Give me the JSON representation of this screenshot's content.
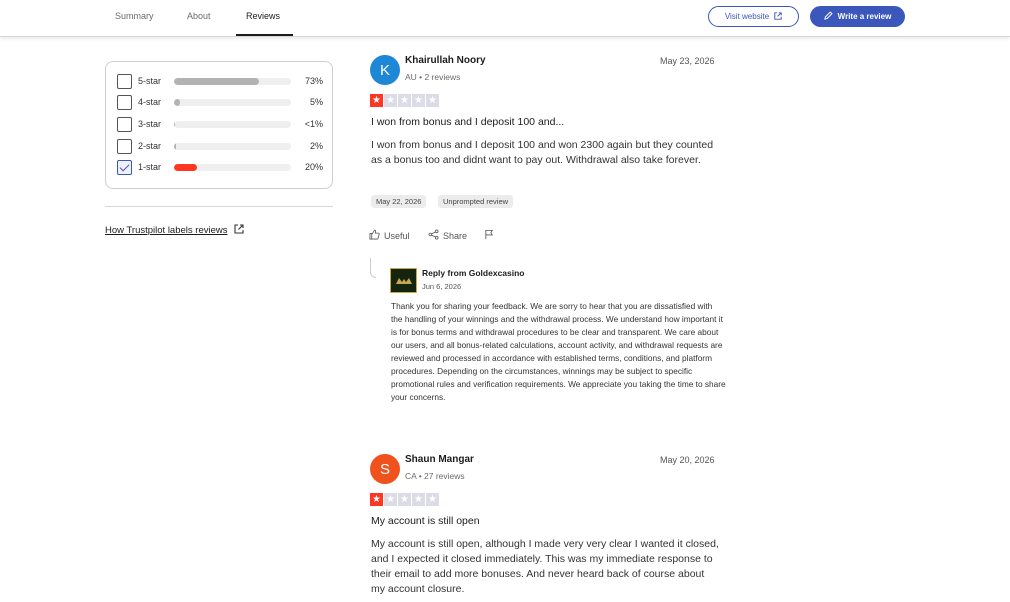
{
  "nav": {
    "tabs": [
      {
        "label": "Summary"
      },
      {
        "label": "About"
      },
      {
        "label": "Reviews"
      }
    ],
    "visit_website": "Visit website",
    "write_review": "Write a review"
  },
  "filters": [
    {
      "label": "5-star",
      "percent": "73%",
      "fraction": 0.73,
      "checked": false,
      "color": "#b3b3b3"
    },
    {
      "label": "4-star",
      "percent": "5%",
      "fraction": 0.05,
      "checked": false,
      "color": "#b3b3b3"
    },
    {
      "label": "3-star",
      "percent": "<1%",
      "fraction": 0.01,
      "checked": false,
      "color": "#b3b3b3"
    },
    {
      "label": "2-star",
      "percent": "2%",
      "fraction": 0.02,
      "checked": false,
      "color": "#b3b3b3"
    },
    {
      "label": "1-star",
      "percent": "20%",
      "fraction": 0.2,
      "checked": true,
      "color": "#ff3722"
    }
  ],
  "how_link": "How Trustpilot labels reviews",
  "reviews": [
    {
      "initial": "K",
      "avatar_color": "#1e88d6",
      "name": "Khairullah Noory",
      "meta": "AU • 2 reviews",
      "date": "May 23, 2026",
      "rating": 1,
      "title": "I won from bonus and I deposit 100 and...",
      "body": "I won from bonus and I deposit 100 and won 2300 again but they counted as a bonus too and didnt want to pay out. Withdrawal also take forever.",
      "experience_date": "May 22, 2026",
      "tag": "Unprompted review",
      "useful": "Useful",
      "share": "Share",
      "reply": {
        "from": "Reply from Goldexcasino",
        "date": "Jun 6, 2026",
        "body": "Thank you for sharing your feedback. We are sorry to hear that you are dissatisfied with the handling of your winnings and the withdrawal process. We understand how important it is for bonus terms and withdrawal procedures to be clear and transparent. We care about our users, and all bonus-related calculations, account activity, and withdrawal requests are reviewed and processed in accordance with established terms, conditions, and platform procedures. Depending on the circumstances, winnings may be subject to specific promotional rules and verification requirements. We appreciate you taking the time to share your concerns."
      }
    },
    {
      "initial": "S",
      "avatar_color": "#f0521e",
      "name": "Shaun Mangar",
      "meta": "CA • 27 reviews",
      "date": "May 20, 2026",
      "rating": 1,
      "title": "My account is still open",
      "body": "My account is still open, although I made very very clear I wanted it closed, and I expected it closed immediately. This was my immediate response to their email to add more bonuses. And never heard back of course about my account closure."
    }
  ],
  "colors": {
    "brand": "#3c57bc",
    "star_on": "#ff3722",
    "star_off": "#dcdce6"
  }
}
